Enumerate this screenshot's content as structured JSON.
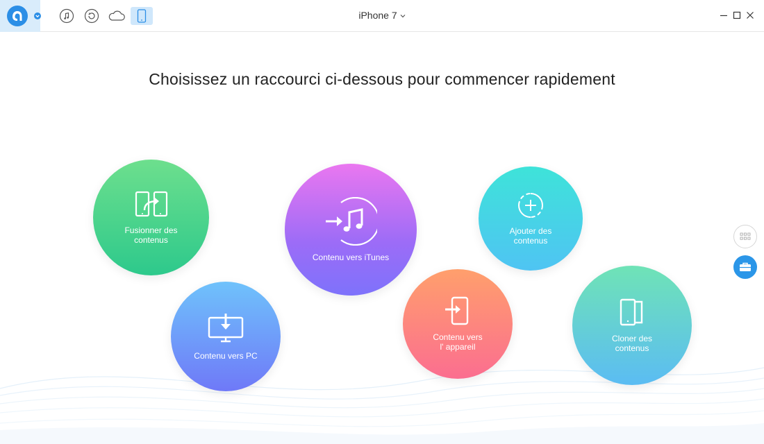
{
  "toolbar": {
    "device_name": "iPhone 7",
    "icons": [
      "app-logo",
      "music-icon",
      "restore-icon",
      "cloud-icon",
      "phone-icon"
    ],
    "active_tab": "phone-icon",
    "accent": "#2b8ee6"
  },
  "main": {
    "heading": "Choisissez un raccourci ci-dessous pour commencer rapidement",
    "shortcuts": [
      {
        "label": "Fusionner des\ncontenus",
        "icon": "merge-icon",
        "color": "#2dc98c"
      },
      {
        "label": "Contenu vers iTunes",
        "icon": "itunes-icon",
        "color": "#9c6cf7"
      },
      {
        "label": "Ajouter des\ncontenus",
        "icon": "add-icon",
        "color": "#4fc4f3"
      },
      {
        "label": "Contenu vers PC",
        "icon": "computer-icon",
        "color": "#6f79f8"
      },
      {
        "label": "Contenu vers\nl' appareil",
        "icon": "to-device-icon",
        "color": "#fb6e90"
      },
      {
        "label": "Cloner des\ncontenus",
        "icon": "clone-icon",
        "color": "#5bbcf3"
      }
    ]
  },
  "side": {
    "icons": [
      "grid-icon",
      "toolbox-icon"
    ]
  }
}
